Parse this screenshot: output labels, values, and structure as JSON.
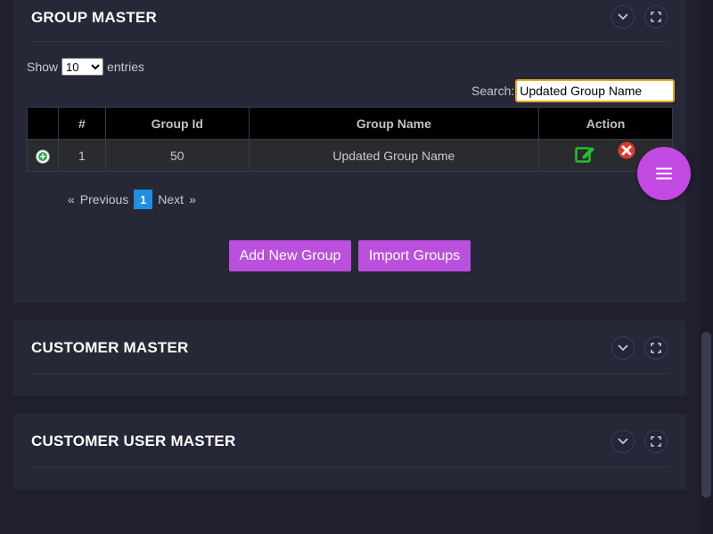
{
  "group_master": {
    "title": "GROUP MASTER",
    "show_label": "Show",
    "entries_label": "entries",
    "page_length": "10",
    "page_length_options": [
      "10"
    ],
    "search_label": "Search:",
    "search_value": "Updated Group Name",
    "columns": [
      "",
      "#",
      "Group Id",
      "Group Name",
      "Action"
    ],
    "rows": [
      {
        "index": "1",
        "group_id": "50",
        "group_name": "Updated Group Name"
      }
    ],
    "pager": {
      "first": "«",
      "previous": "Previous",
      "current": "1",
      "next": "Next",
      "last": "»"
    },
    "add_button": "Add New Group",
    "import_button": "Import Groups"
  },
  "customer_master": {
    "title": "CUSTOMER MASTER"
  },
  "customer_user_master": {
    "title": "CUSTOMER USER MASTER"
  },
  "colors": {
    "background": "#1f1f2e",
    "panel": "#262838",
    "accent_purple": "#bb4fde",
    "edit_green": "#22c02a",
    "delete_red": "#e03a2a",
    "page_blue": "#1f8fdf",
    "search_border": "#e6a817"
  },
  "icons": {
    "collapse": "chevron-down-icon",
    "fullscreen": "expand-icon",
    "edit": "edit-icon",
    "delete": "delete-icon",
    "expand_row": "plus-circle-icon",
    "fab": "hamburger-menu-icon"
  }
}
